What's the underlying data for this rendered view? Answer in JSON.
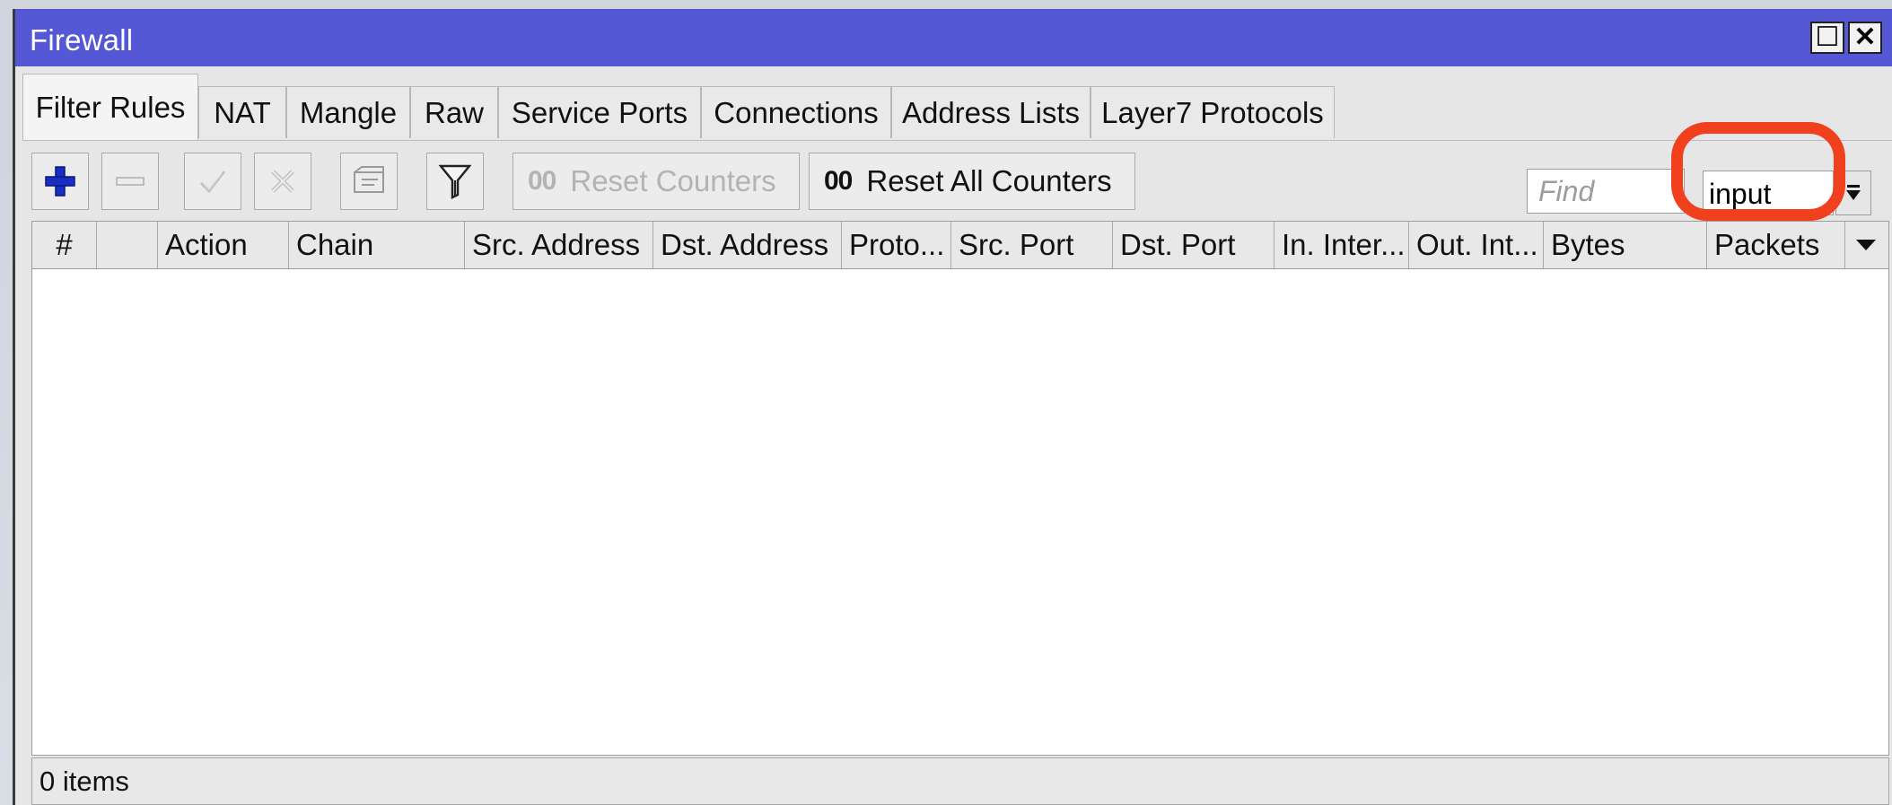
{
  "window": {
    "title": "Firewall",
    "maximize_symbol": "☐",
    "close_symbol": "✕"
  },
  "tabs": [
    {
      "label": "Filter Rules",
      "active": true
    },
    {
      "label": "NAT"
    },
    {
      "label": "Mangle"
    },
    {
      "label": "Raw"
    },
    {
      "label": "Service Ports"
    },
    {
      "label": "Connections"
    },
    {
      "label": "Address Lists"
    },
    {
      "label": "Layer7 Protocols"
    }
  ],
  "toolbar": {
    "add_icon": "plus-icon",
    "remove_icon": "minus-icon",
    "enable_icon": "check-icon",
    "disable_icon": "cross-icon",
    "comment_icon": "comment-icon",
    "filter_icon": "filter-icon",
    "reset_counters_prefix": "00",
    "reset_counters_label": "Reset Counters",
    "reset_all_prefix": "00",
    "reset_all_label": "Reset All Counters",
    "find_placeholder": "Find",
    "chain_value": "input"
  },
  "table": {
    "columns": [
      "#",
      "",
      "Action",
      "Chain",
      "Src. Address",
      "Dst. Address",
      "Proto...",
      "Src. Port",
      "Dst. Port",
      "In. Inter...",
      "Out. Int...",
      "Bytes",
      "Packets"
    ],
    "rows": []
  },
  "status": {
    "text": "0 items"
  },
  "colors": {
    "titlebar": "#5458d4",
    "add_icon": "#1a2fc2",
    "highlight": "#f0401e"
  }
}
